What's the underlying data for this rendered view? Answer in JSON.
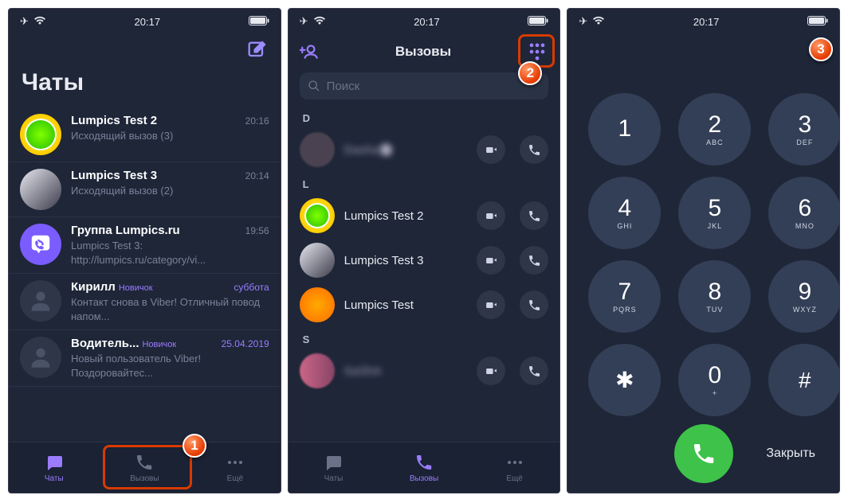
{
  "status": {
    "time": "20:17"
  },
  "screen1": {
    "title": "Чаты",
    "chats": [
      {
        "name": "Lumpics Test 2",
        "sub": "Исходящий вызов (3)",
        "time": "20:16"
      },
      {
        "name": "Lumpics Test 3",
        "sub": "Исходящий вызов (2)",
        "time": "20:14"
      },
      {
        "name": "Группа Lumpics.ru",
        "sub": "Lumpics Test 3: http://lumpics.ru/category/vi...",
        "time": "19:56"
      },
      {
        "name": "Кирилл",
        "tag": "Новичок",
        "sub": "Контакт снова в Viber! Отличный повод напом...",
        "time": "суббота"
      },
      {
        "name": "Водитель...",
        "tag": "Новичок",
        "sub": "Новый пользователь Viber! Поздоровайтес...",
        "time": "25.04.2019"
      }
    ],
    "tabs": {
      "chats": "Чаты",
      "calls": "Вызовы",
      "more": "Ещё"
    }
  },
  "screen2": {
    "title": "Вызовы",
    "search_placeholder": "Поиск",
    "sections": {
      "D": [
        {
          "name": "Dasha🌸"
        }
      ],
      "L": [
        {
          "name": "Lumpics Test 2"
        },
        {
          "name": "Lumpics Test 3"
        },
        {
          "name": "Lumpics Test"
        }
      ],
      "S": [
        {
          "name": "SaShA"
        }
      ]
    },
    "tabs": {
      "chats": "Чаты",
      "calls": "Вызовы",
      "more": "Ещё"
    }
  },
  "screen3": {
    "keys": [
      {
        "d": "1",
        "l": ""
      },
      {
        "d": "2",
        "l": "ABC"
      },
      {
        "d": "3",
        "l": "DEF"
      },
      {
        "d": "4",
        "l": "GHI"
      },
      {
        "d": "5",
        "l": "JKL"
      },
      {
        "d": "6",
        "l": "MNO"
      },
      {
        "d": "7",
        "l": "PQRS"
      },
      {
        "d": "8",
        "l": "TUV"
      },
      {
        "d": "9",
        "l": "WXYZ"
      },
      {
        "d": "✱",
        "l": ""
      },
      {
        "d": "0",
        "l": "+"
      },
      {
        "d": "#",
        "l": ""
      }
    ],
    "close": "Закрыть"
  },
  "markers": {
    "m1": "1",
    "m2": "2",
    "m3": "3"
  }
}
